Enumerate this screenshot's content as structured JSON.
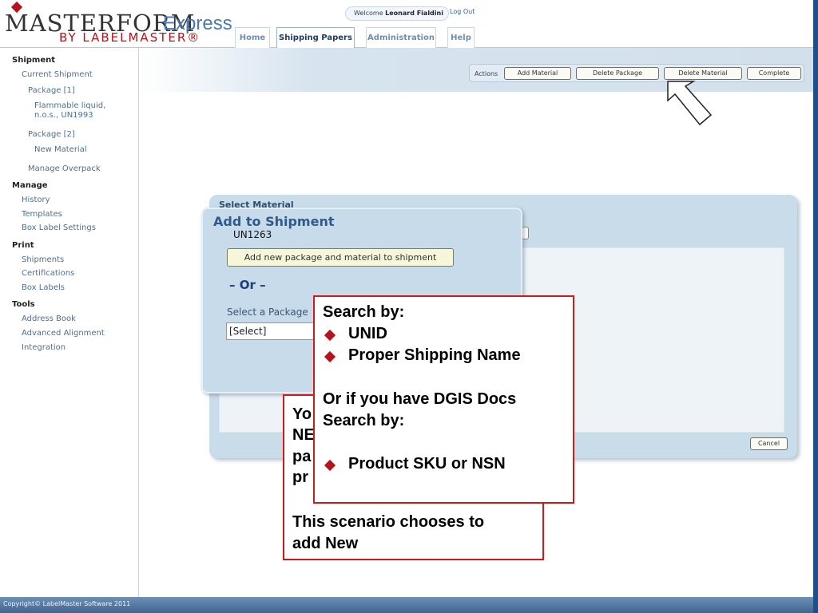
{
  "header": {
    "logo_main": "MASTERFORM",
    "logo_express": "Express",
    "logo_sub": "BY LABELMASTER®",
    "welcome_prefix": "Welcome",
    "user_name": "Leonard Fialdini",
    "logout": "Log Out"
  },
  "tabs": [
    {
      "label": "Home",
      "active": false
    },
    {
      "label": "Shipping Papers",
      "active": true
    },
    {
      "label": "Administration",
      "active": false
    },
    {
      "label": "Help",
      "active": false
    }
  ],
  "sidebar": {
    "shipment_head": "Shipment",
    "current_shipment": "Current Shipment",
    "package1": "Package [1]",
    "material1_line1": "Flammable liquid,",
    "material1_line2": "n.o.s., UN1993",
    "package2": "Package [2]",
    "new_material": "New Material",
    "manage_overpack": "Manage Overpack",
    "manage_head": "Manage",
    "history": "History",
    "templates": "Templates",
    "box_label_settings": "Box Label Settings",
    "print_head": "Print",
    "shipments": "Shipments",
    "certifications": "Certifications",
    "box_labels": "Box Labels",
    "tools_head": "Tools",
    "address_book": "Address Book",
    "advanced_alignment": "Advanced Alignment",
    "integration": "Integration"
  },
  "actions": {
    "label": "Actions",
    "add_material": "Add Material",
    "delete_package": "Delete Package",
    "delete_material": "Delete Material",
    "complete": "Complete"
  },
  "select_panel": {
    "title": "Select Material",
    "cancel": "Cancel"
  },
  "add_dialog": {
    "title": "Add to Shipment",
    "un": "UN1263",
    "add_new_button": "Add new package and material to shipment",
    "or": "– Or –",
    "package_label": "Select a Package",
    "package_select": "[Select]"
  },
  "callout_back": {
    "line1": "Yo",
    "line2": "NE",
    "line3": "pa",
    "line4": "pr",
    "line5": "This scenario chooses to",
    "line6": "add New"
  },
  "callout_front": {
    "search_by": "Search by:",
    "unid": "UNID",
    "psn": "Proper Shipping Name",
    "or_dgis": "Or if you have DGIS Docs",
    "search_by2": "Search by:",
    "sku": "Product SKU or NSN"
  },
  "footer": {
    "copyright": "Copyright© LabelMaster Software 2011"
  },
  "colors": {
    "accent_red": "#b5121b",
    "callout_border": "#d01919",
    "panel_blue": "#c9dcea",
    "footer_blue": "#3f6591"
  }
}
